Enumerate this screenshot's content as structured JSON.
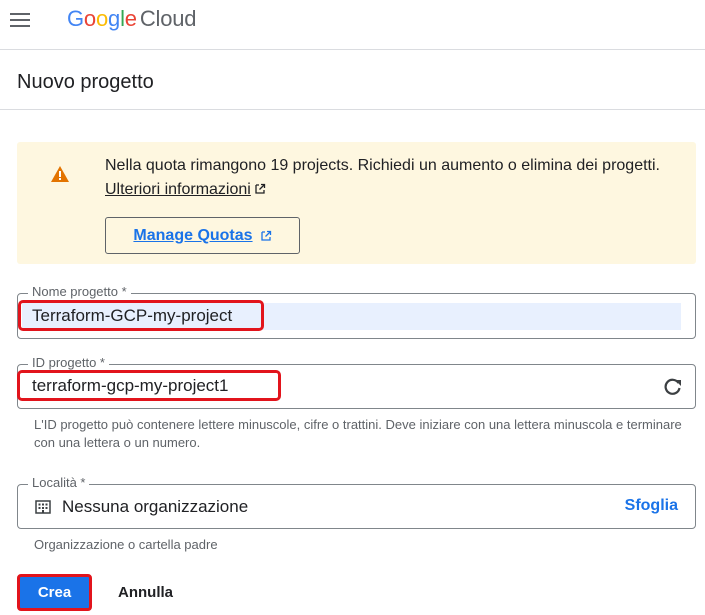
{
  "header": {
    "logo": {
      "G": "G",
      "o1": "o",
      "o2": "o",
      "g": "g",
      "l": "l",
      "e": "e",
      "product": "Cloud"
    },
    "icons": {
      "menu": "hamburger-menu-icon"
    }
  },
  "page": {
    "title": "Nuovo progetto"
  },
  "warning": {
    "text": "Nella quota rimangono 19 projects. Richiedi un aumento o elimina dei progetti. ",
    "link": "Ulteriori informazioni",
    "button_label": "Manage Quotas",
    "colors": {
      "background": "#fef7e0",
      "icon": "#e37400"
    }
  },
  "form": {
    "project_name": {
      "label": "Nome progetto *",
      "value": "Terraform-GCP-my-project"
    },
    "project_id": {
      "label": "ID progetto *",
      "value": "terraform-gcp-my-project1",
      "helper": "L'ID progetto può contenere lettere minuscole, cifre o trattini. Deve iniziare con una lettera minuscola e terminare con una lettera o un numero."
    },
    "location": {
      "label": "Località *",
      "value": "Nessuna organizzazione",
      "browse": "Sfoglia",
      "helper": "Organizzazione o cartella padre"
    }
  },
  "actions": {
    "create": "Crea",
    "cancel": "Annulla"
  },
  "colors": {
    "accent": "#1a73e8",
    "annotation_red": "#e2141c"
  }
}
